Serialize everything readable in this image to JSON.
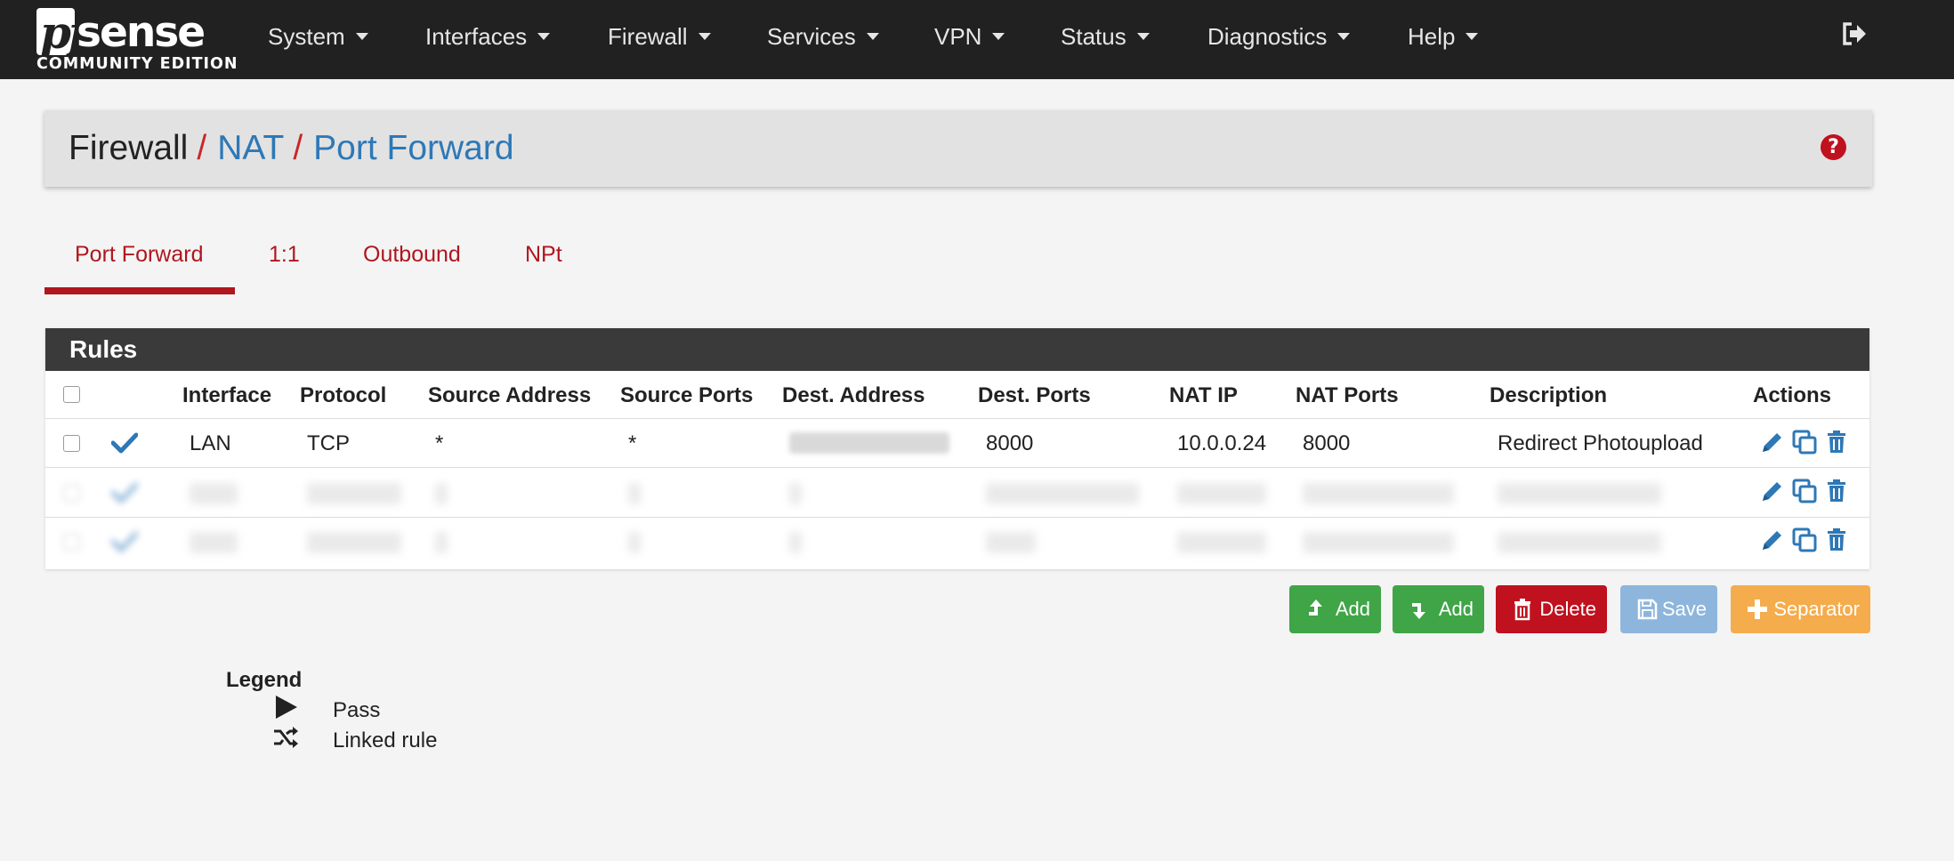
{
  "brand": {
    "logo_pf": "pf",
    "logo_sense": "sense",
    "edition": "COMMUNITY EDITION"
  },
  "nav": [
    {
      "label": "System"
    },
    {
      "label": "Interfaces"
    },
    {
      "label": "Firewall"
    },
    {
      "label": "Services"
    },
    {
      "label": "VPN"
    },
    {
      "label": "Status"
    },
    {
      "label": "Diagnostics"
    },
    {
      "label": "Help"
    }
  ],
  "breadcrumb": {
    "item1": "Firewall",
    "item2": "NAT",
    "item3": "Port Forward",
    "sep": "/"
  },
  "help_icon": "question-circle-icon",
  "tabs": [
    {
      "label": "Port Forward",
      "active": true
    },
    {
      "label": "1:1"
    },
    {
      "label": "Outbound"
    },
    {
      "label": "NPt"
    }
  ],
  "panel": {
    "title": "Rules",
    "headers": [
      "Interface",
      "Protocol",
      "Source Address",
      "Source Ports",
      "Dest. Address",
      "Dest. Ports",
      "NAT IP",
      "NAT Ports",
      "Description",
      "Actions"
    ],
    "rows": [
      {
        "interface": "LAN",
        "protocol": "TCP",
        "src_addr": "*",
        "src_ports": "*",
        "dst_ports": "8000",
        "nat_ip": "10.0.0.24",
        "nat_ports": "8000",
        "description": "Redirect Photoupload"
      }
    ]
  },
  "buttons": {
    "add_top": "Add",
    "add_bottom": "Add",
    "delete": "Delete",
    "save": "Save",
    "separator": "Separator"
  },
  "legend": {
    "title": "Legend",
    "pass": "Pass",
    "linked": "Linked rule"
  },
  "colors": {
    "navbar": "#212121",
    "accent_red": "#b0161e",
    "link_blue": "#2e78b6",
    "success": "#3fa547",
    "danger": "#c0111f",
    "info": "#8eb6dc",
    "warning": "#f5ac4c"
  }
}
